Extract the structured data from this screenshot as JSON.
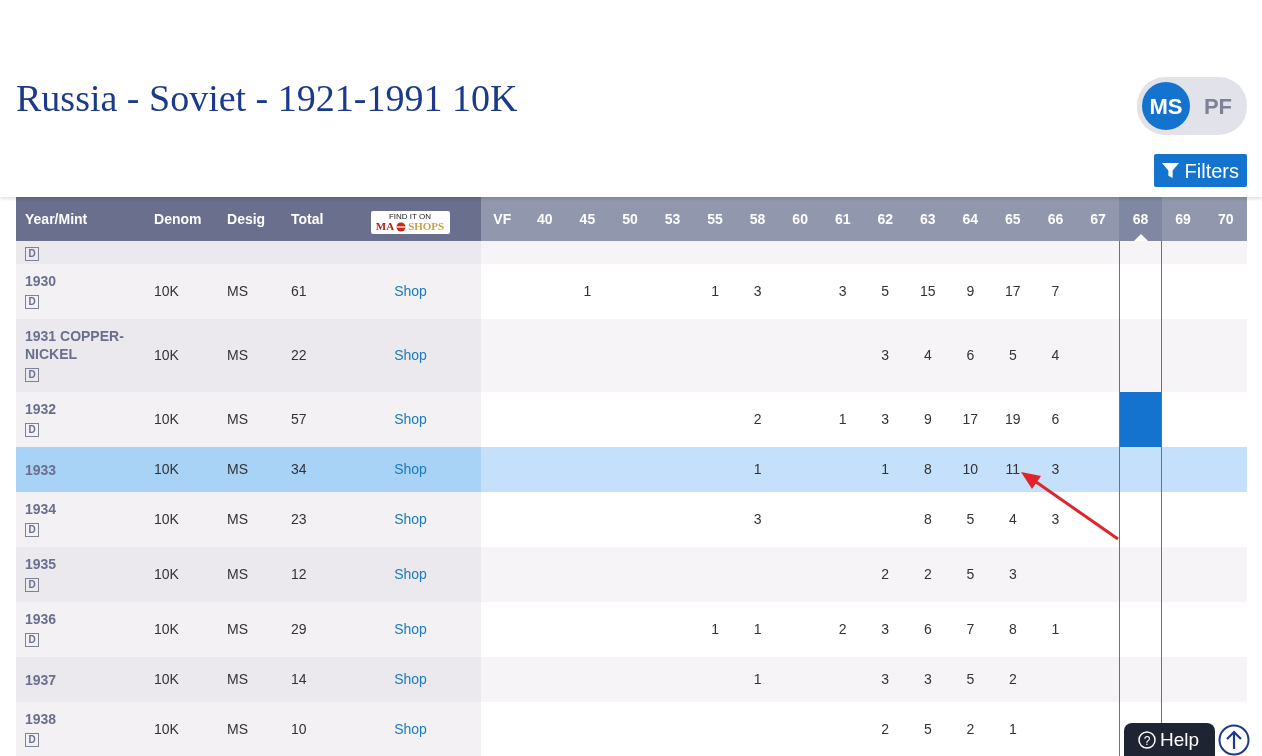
{
  "title": "Russia - Soviet - 1921-1991 10K",
  "toggle": [
    {
      "label": "MS",
      "selected": true
    },
    {
      "label": "PF",
      "selected": false
    }
  ],
  "filters_button": {
    "label": "Filters"
  },
  "table": {
    "columns": [
      "Year/Mint",
      "Denom",
      "Desig",
      "Total"
    ],
    "shop_logo": {
      "line1": "FIND IT ON",
      "left": "MA",
      "right": "SHOPS"
    },
    "grades": [
      {
        "label": "VF",
        "selected": false
      },
      {
        "label": "40",
        "selected": false
      },
      {
        "label": "45",
        "selected": false
      },
      {
        "label": "50",
        "selected": false
      },
      {
        "label": "53",
        "selected": false
      },
      {
        "label": "55",
        "selected": false
      },
      {
        "label": "58",
        "selected": false
      },
      {
        "label": "60",
        "selected": false
      },
      {
        "label": "61",
        "selected": false
      },
      {
        "label": "62",
        "selected": false
      },
      {
        "label": "63",
        "selected": false
      },
      {
        "label": "64",
        "selected": false
      },
      {
        "label": "65",
        "selected": false
      },
      {
        "label": "66",
        "selected": false
      },
      {
        "label": "67",
        "selected": false
      },
      {
        "label": "68",
        "selected": true
      },
      {
        "label": "69",
        "selected": false
      },
      {
        "label": "70",
        "selected": false
      }
    ],
    "partial_row": {
      "badge": "D"
    },
    "rows": [
      {
        "year": "1930",
        "badge": "D",
        "denom": "10K",
        "desig": "MS",
        "total": "61",
        "shop": "Shop",
        "selected": false,
        "cells": [
          {
            "kind": "blank"
          },
          {
            "kind": "blank"
          },
          {
            "kind": "count",
            "count": "1"
          },
          {
            "kind": "blank"
          },
          {
            "kind": "blank"
          },
          {
            "kind": "count",
            "count": "1"
          },
          {
            "kind": "count",
            "count": "3"
          },
          {
            "kind": "blank"
          },
          {
            "kind": "count",
            "count": "3"
          },
          {
            "kind": "count",
            "count": "5"
          },
          {
            "kind": "count",
            "count": "15"
          },
          {
            "kind": "count",
            "count": "9"
          },
          {
            "kind": "count",
            "count": "17"
          },
          {
            "kind": "count",
            "count": "7"
          },
          {
            "kind": "blank"
          },
          {
            "kind": "blank"
          },
          {
            "kind": "blank"
          },
          {
            "kind": "blank"
          }
        ]
      },
      {
        "year": "1931 COPPER-NICKEL",
        "badge": "D",
        "denom": "10K",
        "desig": "MS",
        "total": "22",
        "shop": "Shop",
        "selected": false,
        "cells": [
          {
            "kind": "blank"
          },
          {
            "kind": "blank"
          },
          {
            "kind": "blank"
          },
          {
            "kind": "blank"
          },
          {
            "kind": "blank"
          },
          {
            "kind": "blank"
          },
          {
            "kind": "blank"
          },
          {
            "kind": "blank"
          },
          {
            "kind": "blank"
          },
          {
            "kind": "count",
            "count": "3"
          },
          {
            "kind": "count",
            "count": "4"
          },
          {
            "kind": "count",
            "count": "6"
          },
          {
            "kind": "count",
            "count": "5"
          },
          {
            "kind": "count",
            "count": "4"
          },
          {
            "kind": "blank"
          },
          {
            "kind": "blank"
          },
          {
            "kind": "blank"
          },
          {
            "kind": "blank"
          }
        ]
      },
      {
        "year": "1932",
        "badge": "D",
        "denom": "10K",
        "desig": "MS",
        "total": "57",
        "shop": "Shop",
        "selected": false,
        "cells": [
          {
            "kind": "blank"
          },
          {
            "kind": "blank"
          },
          {
            "kind": "blank"
          },
          {
            "kind": "blank"
          },
          {
            "kind": "blank"
          },
          {
            "kind": "blank"
          },
          {
            "kind": "count",
            "count": "2"
          },
          {
            "kind": "blank"
          },
          {
            "kind": "count",
            "count": "1"
          },
          {
            "kind": "count",
            "count": "3"
          },
          {
            "kind": "count",
            "count": "9"
          },
          {
            "kind": "count",
            "count": "17"
          },
          {
            "kind": "count",
            "count": "19"
          },
          {
            "kind": "count",
            "count": "6"
          },
          {
            "kind": "blank"
          },
          {
            "kind": "bar"
          },
          {
            "kind": "blank"
          },
          {
            "kind": "blank"
          }
        ]
      },
      {
        "year": "1933",
        "denom": "10K",
        "desig": "MS",
        "total": "34",
        "shop": "Shop",
        "selected": true,
        "cells": [
          {
            "kind": "blank"
          },
          {
            "kind": "blank"
          },
          {
            "kind": "blank"
          },
          {
            "kind": "blank"
          },
          {
            "kind": "blank"
          },
          {
            "kind": "blank"
          },
          {
            "kind": "count",
            "count": "1"
          },
          {
            "kind": "blank"
          },
          {
            "kind": "blank"
          },
          {
            "kind": "count",
            "count": "1"
          },
          {
            "kind": "count",
            "count": "8"
          },
          {
            "kind": "count",
            "count": "10"
          },
          {
            "kind": "count",
            "count": "11"
          },
          {
            "kind": "count",
            "count": "3"
          },
          {
            "kind": "blank"
          },
          {
            "kind": "blank"
          },
          {
            "kind": "blank"
          },
          {
            "kind": "blank"
          }
        ]
      },
      {
        "year": "1934",
        "badge": "D",
        "denom": "10K",
        "desig": "MS",
        "total": "23",
        "shop": "Shop",
        "selected": false,
        "cells": [
          {
            "kind": "blank"
          },
          {
            "kind": "blank"
          },
          {
            "kind": "blank"
          },
          {
            "kind": "blank"
          },
          {
            "kind": "blank"
          },
          {
            "kind": "blank"
          },
          {
            "kind": "count",
            "count": "3"
          },
          {
            "kind": "blank"
          },
          {
            "kind": "blank"
          },
          {
            "kind": "blank"
          },
          {
            "kind": "count",
            "count": "8"
          },
          {
            "kind": "count",
            "count": "5"
          },
          {
            "kind": "count",
            "count": "4"
          },
          {
            "kind": "count",
            "count": "3"
          },
          {
            "kind": "blank"
          },
          {
            "kind": "blank"
          },
          {
            "kind": "blank"
          },
          {
            "kind": "blank"
          }
        ]
      },
      {
        "year": "1935",
        "badge": "D",
        "denom": "10K",
        "desig": "MS",
        "total": "12",
        "shop": "Shop",
        "selected": false,
        "cells": [
          {
            "kind": "blank"
          },
          {
            "kind": "blank"
          },
          {
            "kind": "blank"
          },
          {
            "kind": "blank"
          },
          {
            "kind": "blank"
          },
          {
            "kind": "blank"
          },
          {
            "kind": "blank"
          },
          {
            "kind": "blank"
          },
          {
            "kind": "blank"
          },
          {
            "kind": "count",
            "count": "2"
          },
          {
            "kind": "count",
            "count": "2"
          },
          {
            "kind": "count",
            "count": "5"
          },
          {
            "kind": "count",
            "count": "3"
          },
          {
            "kind": "blank"
          },
          {
            "kind": "blank"
          },
          {
            "kind": "blank"
          },
          {
            "kind": "blank"
          },
          {
            "kind": "blank"
          }
        ]
      },
      {
        "year": "1936",
        "badge": "D",
        "denom": "10K",
        "desig": "MS",
        "total": "29",
        "shop": "Shop",
        "selected": false,
        "cells": [
          {
            "kind": "blank"
          },
          {
            "kind": "blank"
          },
          {
            "kind": "blank"
          },
          {
            "kind": "blank"
          },
          {
            "kind": "blank"
          },
          {
            "kind": "count",
            "count": "1"
          },
          {
            "kind": "count",
            "count": "1"
          },
          {
            "kind": "blank"
          },
          {
            "kind": "count",
            "count": "2"
          },
          {
            "kind": "count",
            "count": "3"
          },
          {
            "kind": "count",
            "count": "6"
          },
          {
            "kind": "count",
            "count": "7"
          },
          {
            "kind": "count",
            "count": "8"
          },
          {
            "kind": "count",
            "count": "1"
          },
          {
            "kind": "blank"
          },
          {
            "kind": "blank"
          },
          {
            "kind": "blank"
          },
          {
            "kind": "blank"
          }
        ]
      },
      {
        "year": "1937",
        "denom": "10K",
        "desig": "MS",
        "total": "14",
        "shop": "Shop",
        "selected": false,
        "cells": [
          {
            "kind": "blank"
          },
          {
            "kind": "blank"
          },
          {
            "kind": "blank"
          },
          {
            "kind": "blank"
          },
          {
            "kind": "blank"
          },
          {
            "kind": "blank"
          },
          {
            "kind": "count",
            "count": "1"
          },
          {
            "kind": "blank"
          },
          {
            "kind": "blank"
          },
          {
            "kind": "count",
            "count": "3"
          },
          {
            "kind": "count",
            "count": "3"
          },
          {
            "kind": "count",
            "count": "5"
          },
          {
            "kind": "count",
            "count": "2"
          },
          {
            "kind": "blank"
          },
          {
            "kind": "blank"
          },
          {
            "kind": "blank"
          },
          {
            "kind": "blank"
          },
          {
            "kind": "blank"
          }
        ]
      },
      {
        "year": "1938",
        "badge": "D",
        "denom": "10K",
        "desig": "MS",
        "total": "10",
        "shop": "Shop",
        "selected": false,
        "cells": [
          {
            "kind": "blank"
          },
          {
            "kind": "blank"
          },
          {
            "kind": "blank"
          },
          {
            "kind": "blank"
          },
          {
            "kind": "blank"
          },
          {
            "kind": "blank"
          },
          {
            "kind": "blank"
          },
          {
            "kind": "blank"
          },
          {
            "kind": "blank"
          },
          {
            "kind": "count",
            "count": "2"
          },
          {
            "kind": "count",
            "count": "5"
          },
          {
            "kind": "count",
            "count": "2"
          },
          {
            "kind": "count",
            "count": "1"
          },
          {
            "kind": "blank"
          },
          {
            "kind": "blank"
          },
          {
            "kind": "blank"
          },
          {
            "kind": "blank"
          },
          {
            "kind": "blank"
          }
        ]
      }
    ]
  },
  "help_button": {
    "icon": "?",
    "label": "Help"
  }
}
